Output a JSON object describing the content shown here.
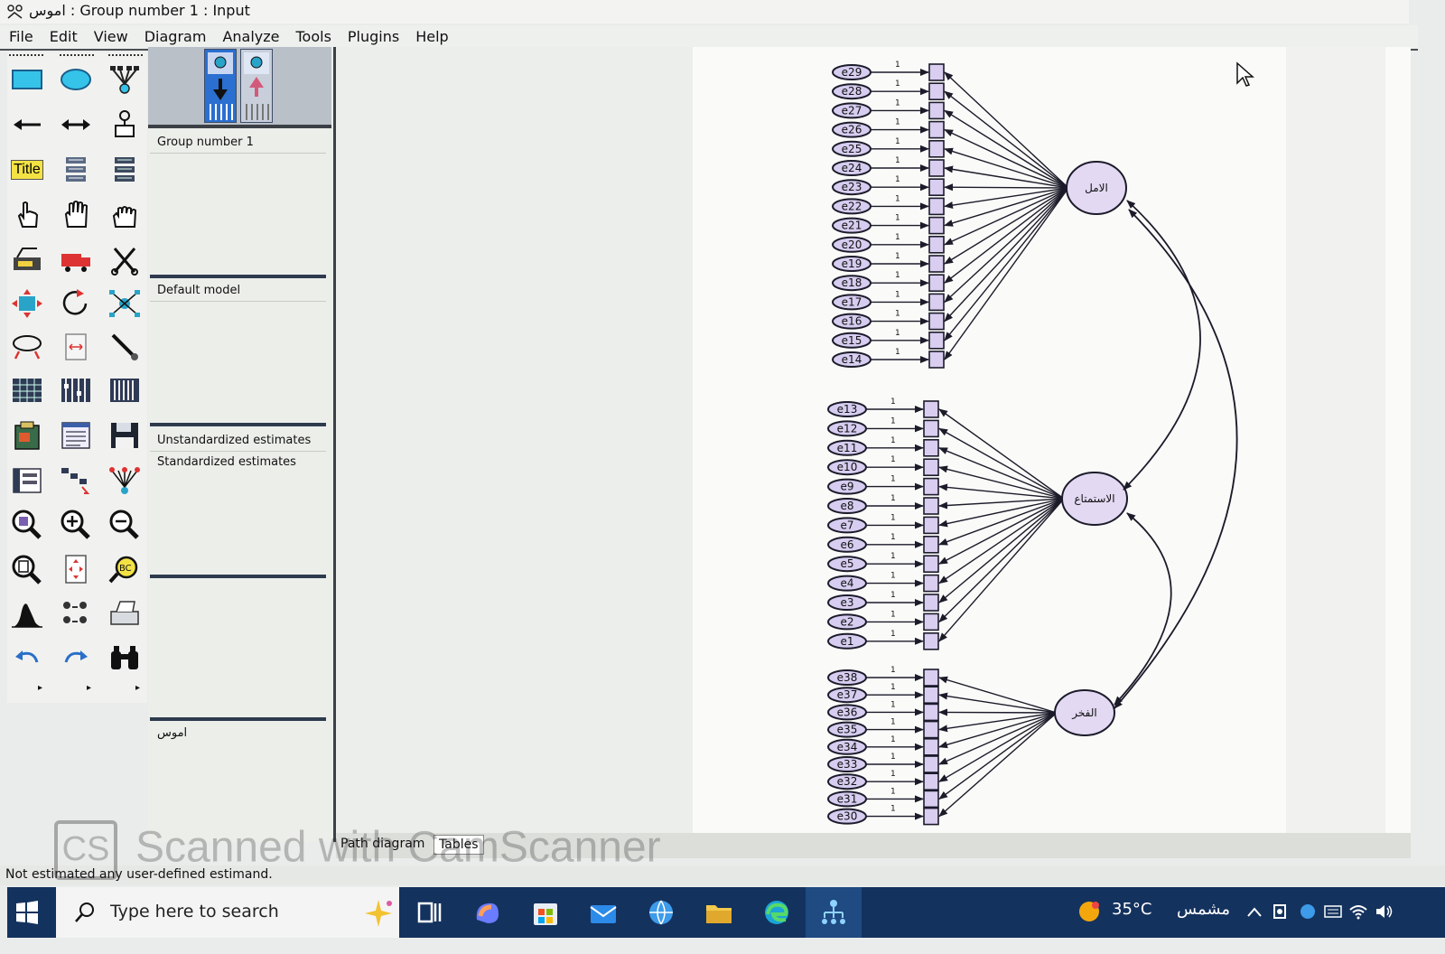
{
  "window": {
    "title": "اموس : Group number 1 : Input"
  },
  "menu": [
    "File",
    "Edit",
    "View",
    "Diagram",
    "Analyze",
    "Tools",
    "Plugins",
    "Help"
  ],
  "toolbox": {
    "title_tool_label": "Title"
  },
  "panel": {
    "groups": [
      "Group number 1"
    ],
    "models": [
      "Default model"
    ],
    "estimates": [
      "Unstandardized estimates",
      "Standardized estimates"
    ],
    "file_name": "اموس"
  },
  "diagram": {
    "path_weight_label": "1",
    "factor1": {
      "name": "الامل",
      "errors": [
        "e29",
        "e28",
        "e27",
        "e26",
        "e25",
        "e24",
        "e23",
        "e22",
        "e21",
        "e20",
        "e19",
        "e18",
        "e17",
        "e16",
        "e15",
        "e14"
      ]
    },
    "factor2": {
      "name": "الاستمتاع",
      "errors": [
        "e13",
        "e12",
        "e11",
        "e10",
        "e9",
        "e8",
        "e7",
        "e6",
        "e5",
        "e4",
        "e3",
        "e2",
        "e1"
      ]
    },
    "factor3": {
      "name": "الفخر",
      "errors": [
        "e38",
        "e37",
        "e36",
        "e35",
        "e34",
        "e33",
        "e32",
        "e31",
        "e30"
      ]
    },
    "colors": {
      "indicator_fill": "#d9cdf0",
      "latent_fill": "#e3d9f3",
      "error_fill": "#d6cdf0",
      "stroke": "#1b1b2a"
    }
  },
  "tabs": [
    "Path diagram",
    "Tables"
  ],
  "status": "Not estimated any user-defined estimand.",
  "watermark": {
    "logo": "CS",
    "text": "Scanned with CamScanner"
  },
  "taskbar": {
    "search_placeholder": "Type here to search",
    "temperature": "35°C",
    "condition": "مشمس",
    "accent": "#14325e"
  }
}
